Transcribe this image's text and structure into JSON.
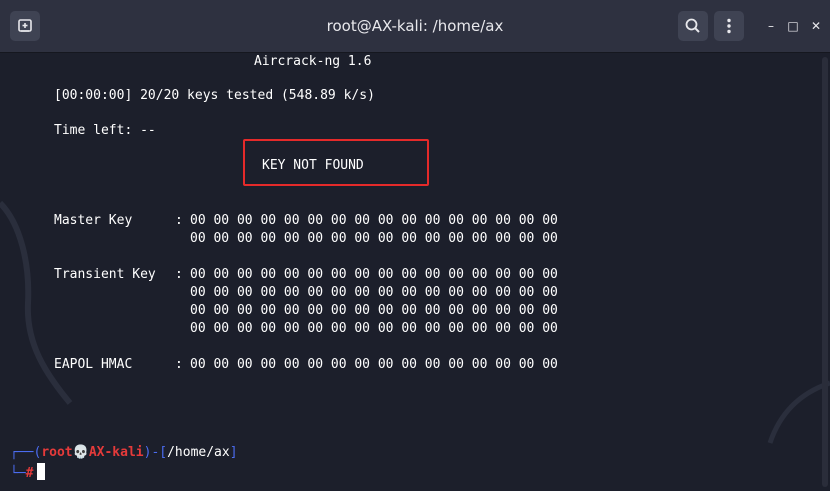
{
  "window": {
    "title": "root@AX-kali: /home/ax",
    "icons": {
      "new_tab": "new-tab-icon",
      "search": "search-icon",
      "menu": "kebab-menu-icon",
      "minimize": "minimize-icon",
      "maximize": "maximize-icon",
      "close": "close-icon"
    },
    "controls": {
      "minimize": "–",
      "maximize": "□",
      "close": "✕"
    }
  },
  "terminal": {
    "header": "Aircrack-ng 1.6",
    "progress": "[00:00:00] 20/20 keys tested (548.89 k/s)",
    "time_left": "Time left: --",
    "result": "KEY NOT FOUND",
    "master_key": {
      "label": "Master Key",
      "rows": [
        "00 00 00 00 00 00 00 00 00 00 00 00 00 00 00 00",
        "00 00 00 00 00 00 00 00 00 00 00 00 00 00 00 00"
      ]
    },
    "transient_key": {
      "label": "Transient Key",
      "rows": [
        "00 00 00 00 00 00 00 00 00 00 00 00 00 00 00 00",
        "00 00 00 00 00 00 00 00 00 00 00 00 00 00 00 00",
        "00 00 00 00 00 00 00 00 00 00 00 00 00 00 00 00",
        "00 00 00 00 00 00 00 00 00 00 00 00 00 00 00 00"
      ]
    },
    "eapol_hmac": {
      "label": "EAPOL HMAC",
      "rows": [
        "00 00 00 00 00 00 00 00 00 00 00 00 00 00 00 00"
      ]
    },
    "colon": ":",
    "prompt": {
      "corner_top": "┌──",
      "open_paren": "(",
      "user": "root",
      "skull": "💀",
      "host": "AX-kali",
      "close_paren": ")",
      "dash": "-",
      "open_bracket": "[",
      "path": "/home/ax",
      "close_bracket": "]",
      "corner_bottom": "└─",
      "symbol": "#"
    }
  },
  "colors": {
    "highlight_border": "#e52a2a",
    "prompt_blue": "#4b6cf0",
    "prompt_red": "#e53a3a"
  }
}
